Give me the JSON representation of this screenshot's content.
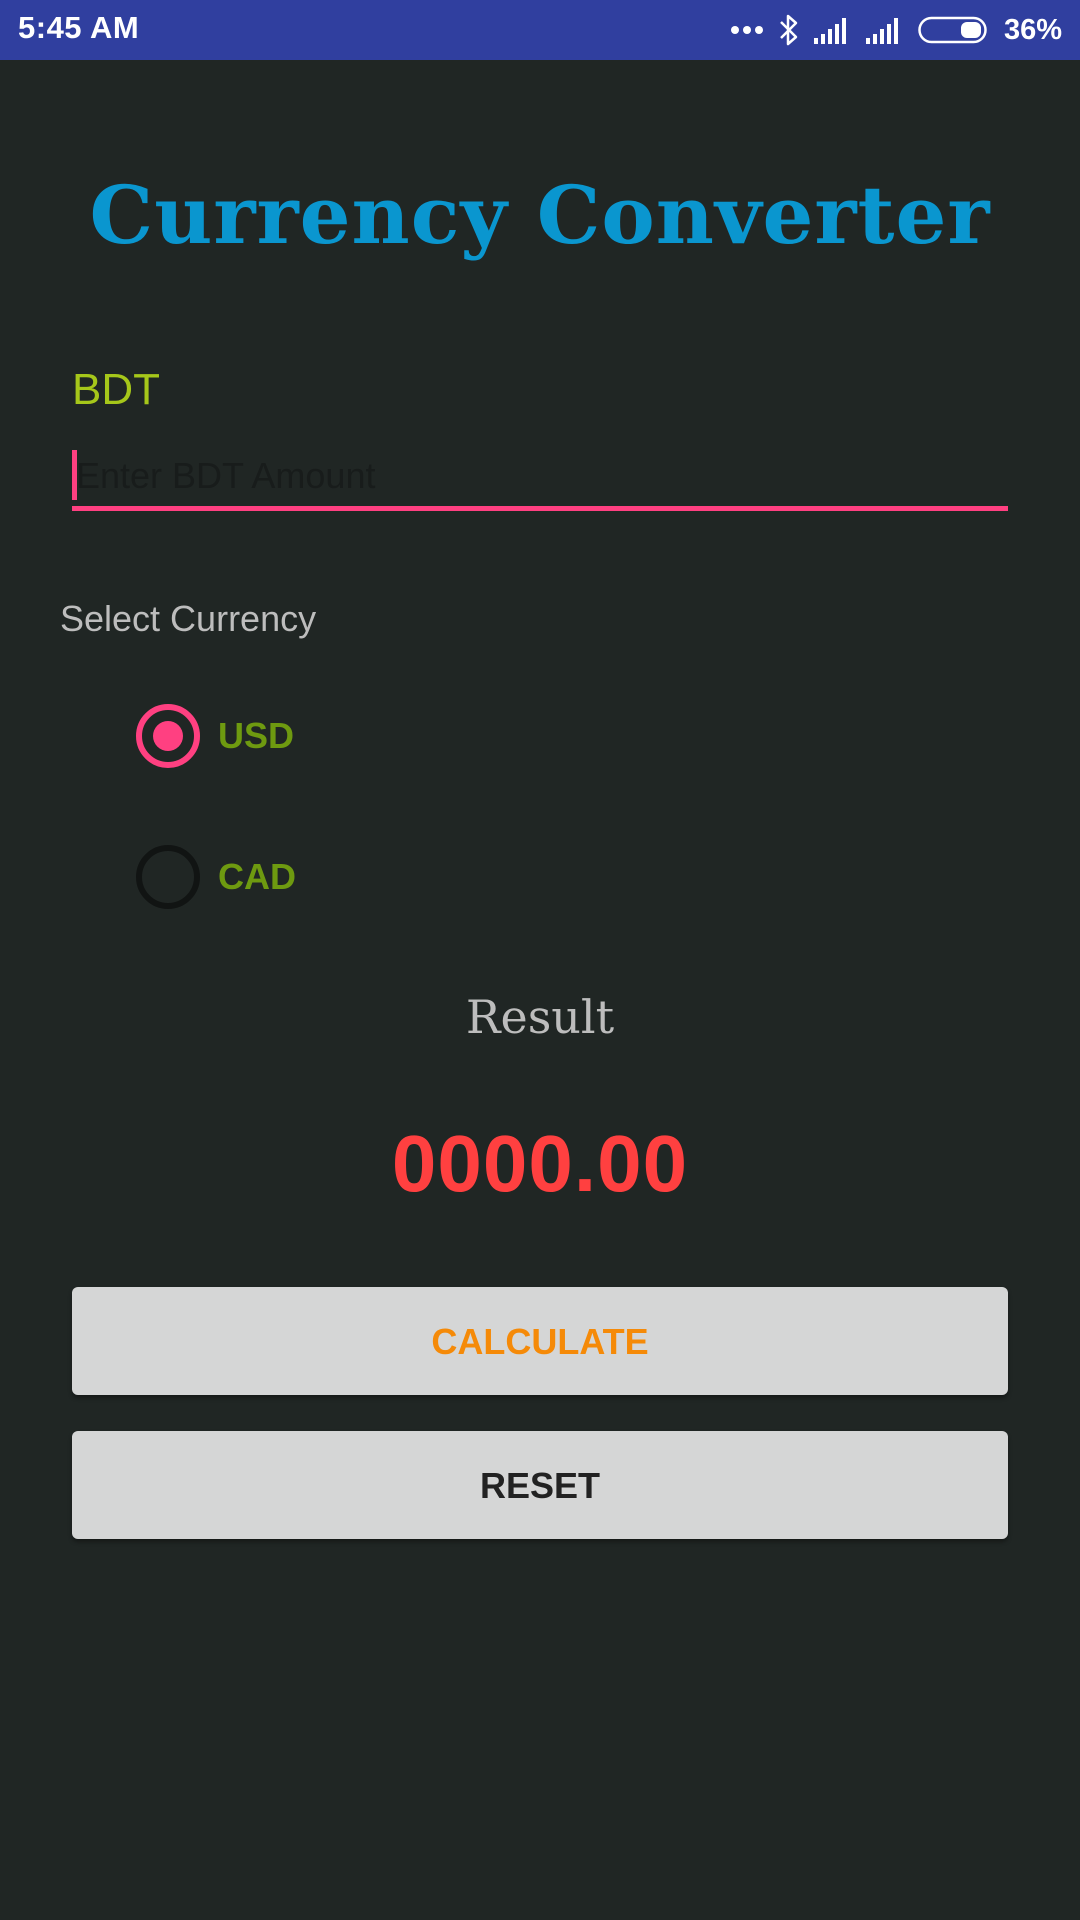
{
  "status_bar": {
    "time": "5:45 AM",
    "battery_percent": "36%",
    "icons": [
      "more-dots-icon",
      "bluetooth-icon",
      "signal-icon",
      "signal-icon",
      "battery-icon"
    ],
    "color": "#303f9f"
  },
  "app": {
    "title": "Currency Converter",
    "title_color": "#0a96cf"
  },
  "input": {
    "label": "BDT",
    "value": "",
    "placeholder": "Enter BDT Amount",
    "accent_color": "#ff4081"
  },
  "currency_select": {
    "label": "Select Currency",
    "options": [
      {
        "label": "USD",
        "checked": true
      },
      {
        "label": "CAD",
        "checked": false
      }
    ]
  },
  "result": {
    "label": "Result",
    "value": "0000.00",
    "color": "#ff4040"
  },
  "buttons": {
    "calculate": "CALCULATE",
    "reset": "RESET"
  }
}
